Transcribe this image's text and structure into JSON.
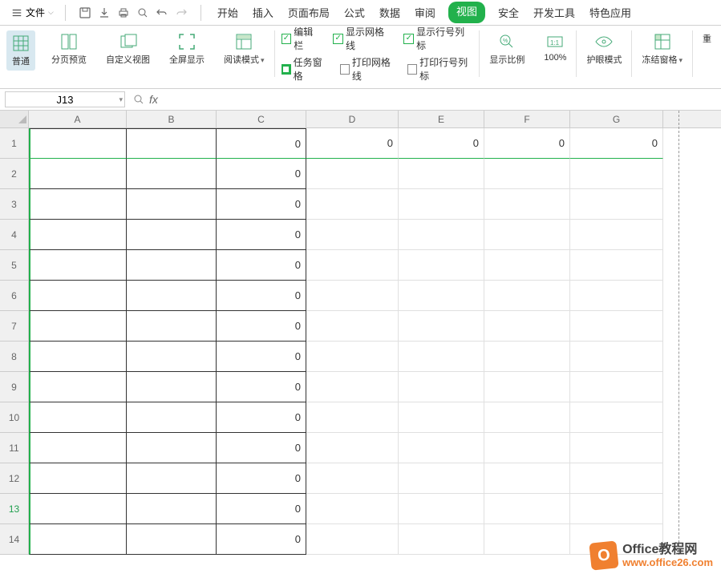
{
  "menu": {
    "file": "文件",
    "tabs": [
      "开始",
      "插入",
      "页面布局",
      "公式",
      "数据",
      "审阅",
      "视图",
      "安全",
      "开发工具",
      "特色应用"
    ],
    "activeTab": "视图"
  },
  "ribbon": {
    "normal": "普通",
    "pageBreak": "分页预览",
    "custom": "自定义视图",
    "fullscreen": "全屏显示",
    "readMode": "阅读模式",
    "checks": {
      "editBar": "编辑栏",
      "taskPane": "任务窗格",
      "showGrid": "显示网格线",
      "printGrid": "打印网格线",
      "showHeaders": "显示行号列标",
      "printHeaders": "打印行号列标"
    },
    "zoom": "显示比例",
    "hundred": "100%",
    "eyeCare": "护眼模式",
    "freeze": "冻结窗格",
    "resetPos": "重"
  },
  "nameBox": "J13",
  "fx": "fx",
  "columns": [
    "A",
    "B",
    "C",
    "D",
    "E",
    "F",
    "G"
  ],
  "rows": [
    {
      "n": "1",
      "c": "0",
      "d": "0",
      "e": "0",
      "f": "0",
      "g": "0"
    },
    {
      "n": "2",
      "c": "0"
    },
    {
      "n": "3",
      "c": "0"
    },
    {
      "n": "4",
      "c": "0"
    },
    {
      "n": "5",
      "c": "0"
    },
    {
      "n": "6",
      "c": "0"
    },
    {
      "n": "7",
      "c": "0"
    },
    {
      "n": "8",
      "c": "0"
    },
    {
      "n": "9",
      "c": "0"
    },
    {
      "n": "10",
      "c": "0"
    },
    {
      "n": "11",
      "c": "0"
    },
    {
      "n": "12",
      "c": "0"
    },
    {
      "n": "13",
      "c": "0",
      "sel": true
    },
    {
      "n": "14",
      "c": "0"
    }
  ],
  "watermark": {
    "icon": "O",
    "title": "Office教程网",
    "url": "www.office26.com"
  }
}
